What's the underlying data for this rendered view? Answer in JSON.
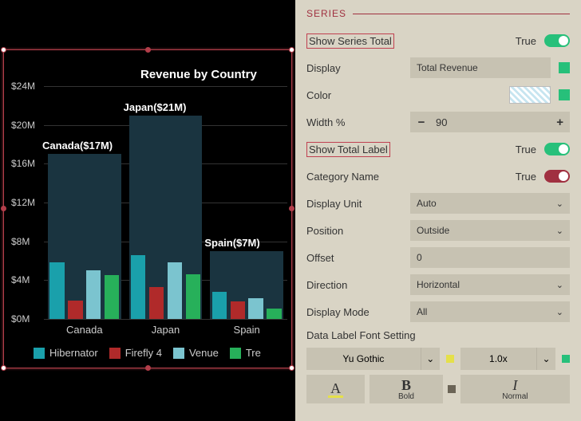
{
  "chart_data": {
    "type": "bar",
    "title": "Revenue by Country",
    "ylabel": "",
    "xlabel": "",
    "ylim": [
      0,
      24
    ],
    "yunit": "$M",
    "categories": [
      "Canada",
      "Japan",
      "Spain"
    ],
    "totals_label": [
      "Canada($17M)",
      "Japan($21M)",
      "Spain($7M)"
    ],
    "series": [
      {
        "name": "Hibernator",
        "color": "#1aa0ab",
        "values": [
          5.8,
          6.6,
          2.8
        ]
      },
      {
        "name": "Firefly 4",
        "color": "#b02a2a",
        "values": [
          1.9,
          3.3,
          1.8
        ]
      },
      {
        "name": "Venue",
        "color": "#7bc4cf",
        "values": [
          5.0,
          5.8,
          2.1
        ]
      },
      {
        "name": "Tre",
        "color": "#27b05a",
        "values": [
          4.5,
          4.6,
          1.1
        ]
      }
    ],
    "yticks": [
      "$0M",
      "$4M",
      "$8M",
      "$12M",
      "$16M",
      "$20M",
      "$24M"
    ]
  },
  "panel": {
    "section": "SERIES",
    "show_series_total": {
      "label": "Show Series Total",
      "value": "True"
    },
    "display": {
      "label": "Display",
      "value": "Total Revenue"
    },
    "color_lbl": "Color",
    "width": {
      "label": "Width %",
      "value": "90"
    },
    "show_total_label": {
      "label": "Show Total Label",
      "value": "True"
    },
    "category_name": {
      "label": "Category Name",
      "value": "True"
    },
    "display_unit": {
      "label": "Display Unit",
      "value": "Auto"
    },
    "position": {
      "label": "Position",
      "value": "Outside"
    },
    "offset": {
      "label": "Offset",
      "value": "0"
    },
    "direction": {
      "label": "Direction",
      "value": "Horizontal"
    },
    "display_mode": {
      "label": "Display Mode",
      "value": "All"
    },
    "font_setting_lbl": "Data Label Font Setting",
    "font_family": "Yu Gothic",
    "font_scale": "1.0x",
    "color_btn": "A",
    "bold_btn_big": "B",
    "bold_btn_small": "Bold",
    "italic_btn_big": "I",
    "italic_btn_small": "Normal"
  }
}
